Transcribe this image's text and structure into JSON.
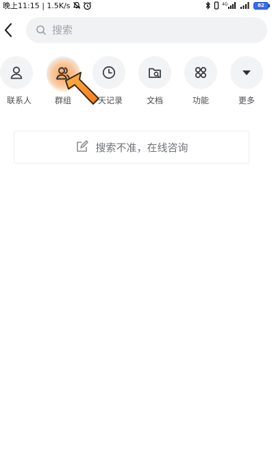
{
  "status_bar": {
    "time_speed": "晚上11:15 | 1.5K/s",
    "battery": "82"
  },
  "search": {
    "placeholder": "搜索",
    "value": ""
  },
  "categories": [
    {
      "label": "联系人",
      "icon": "person-icon"
    },
    {
      "label": "群组",
      "icon": "group-icon"
    },
    {
      "label": "天记录",
      "icon": "clock-icon"
    },
    {
      "label": "文档",
      "icon": "folder-icon"
    },
    {
      "label": "功能",
      "icon": "grid-icon"
    },
    {
      "label": "更多",
      "icon": "caret-down-icon"
    }
  ],
  "feedback": {
    "label": "搜索不准，在线咨询"
  },
  "colors": {
    "icon_stroke": "#3b3e43",
    "circle_bg": "#f2f3f5",
    "highlight": "#ff8a2a",
    "battery": "#3a6ee8"
  }
}
